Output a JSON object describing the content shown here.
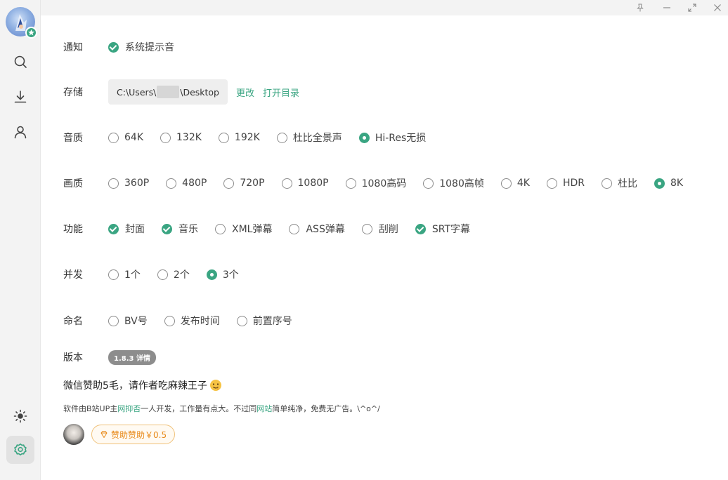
{
  "settings": {
    "notify": {
      "label": "通知",
      "options": [
        {
          "label": "系统提示音",
          "checked": true
        }
      ]
    },
    "storage": {
      "label": "存储",
      "path_prefix": "C:\\Users\\",
      "path_suffix": "\\Desktop",
      "change_label": "更改",
      "open_label": "打开目录"
    },
    "audio": {
      "label": "音质",
      "options": [
        {
          "label": "64K",
          "checked": false
        },
        {
          "label": "132K",
          "checked": false
        },
        {
          "label": "192K",
          "checked": false
        },
        {
          "label": "杜比全景声",
          "checked": false
        },
        {
          "label": "Hi-Res无损",
          "checked": true
        }
      ]
    },
    "video": {
      "label": "画质",
      "options": [
        {
          "label": "360P",
          "checked": false
        },
        {
          "label": "480P",
          "checked": false
        },
        {
          "label": "720P",
          "checked": false
        },
        {
          "label": "1080P",
          "checked": false
        },
        {
          "label": "1080高码",
          "checked": false
        },
        {
          "label": "1080高帧",
          "checked": false
        },
        {
          "label": "4K",
          "checked": false
        },
        {
          "label": "HDR",
          "checked": false
        },
        {
          "label": "杜比",
          "checked": false
        },
        {
          "label": "8K",
          "checked": true
        }
      ]
    },
    "features": {
      "label": "功能",
      "options": [
        {
          "label": "封面",
          "checked": true
        },
        {
          "label": "音乐",
          "checked": true
        },
        {
          "label": "XML弹幕",
          "checked": false
        },
        {
          "label": "ASS弹幕",
          "checked": false
        },
        {
          "label": "刮削",
          "checked": false
        },
        {
          "label": "SRT字幕",
          "checked": true
        }
      ]
    },
    "concurrency": {
      "label": "并发",
      "options": [
        {
          "label": "1个",
          "checked": false
        },
        {
          "label": "2个",
          "checked": false
        },
        {
          "label": "3个",
          "checked": true
        }
      ]
    },
    "naming": {
      "label": "命名",
      "options": [
        {
          "label": "BV号",
          "checked": false
        },
        {
          "label": "发布时间",
          "checked": false
        },
        {
          "label": "前置序号",
          "checked": false
        }
      ]
    },
    "version": {
      "label": "版本",
      "badge": "1.8.3 详情"
    }
  },
  "sponsor": {
    "title": "微信赞助5毛，请作者吃麻辣王子",
    "desc_1": "软件由B站UP主",
    "desc_author": "网抑否",
    "desc_2": "一人开发，工作量有点大。不过同",
    "desc_site": "网站",
    "desc_3": "简单纯净，免费无广告。\\^o^/",
    "button": "赞助赞助￥0.5"
  },
  "colors": {
    "accent": "#3aa582",
    "sponsor_orange": "#e88a1a"
  }
}
